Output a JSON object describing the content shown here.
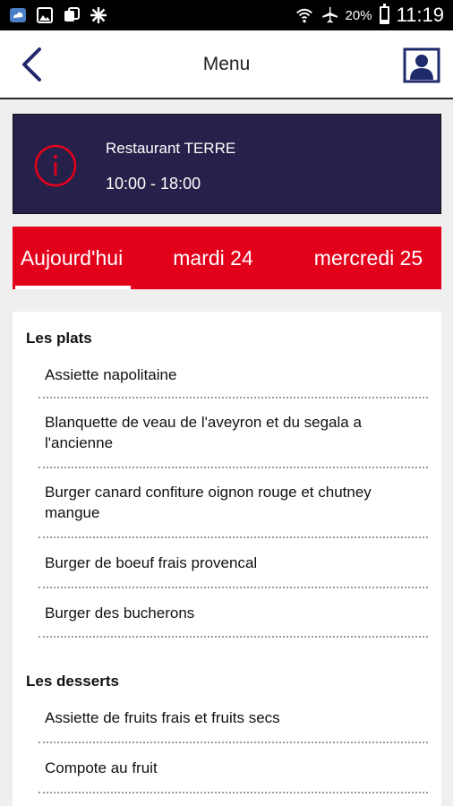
{
  "status_bar": {
    "battery_percent": "20%",
    "battery_level": 0.2,
    "time": "11:19",
    "icons": [
      "weather-icon",
      "image-icon",
      "app-icon",
      "sparkle-icon",
      "wifi-icon",
      "airplane-icon"
    ]
  },
  "app_bar": {
    "title": "Menu",
    "back_icon": "chevron-left-icon",
    "profile_icon": "person-icon"
  },
  "restaurant": {
    "name": "Restaurant TERRE",
    "hours": "10:00 - 18:00",
    "info_icon": "info-icon"
  },
  "tabs": [
    {
      "label": "Aujourd'hui",
      "active": true
    },
    {
      "label": "mardi 24",
      "active": false
    },
    {
      "label": "mercredi 25",
      "active": false
    }
  ],
  "menu": {
    "sections": [
      {
        "title": "Les plats",
        "items": [
          "Assiette napolitaine",
          "Blanquette de veau de l'aveyron et du segala a l'ancienne",
          "Burger canard confiture oignon rouge et chutney mangue",
          "Burger de boeuf frais provencal",
          "Burger des bucherons"
        ]
      },
      {
        "title": "Les desserts",
        "items": [
          "Assiette de fruits frais et fruits secs",
          "Compote au fruit"
        ]
      }
    ]
  },
  "colors": {
    "accent_red": "#e3001b",
    "banner_navy": "#26214a",
    "brand_blue": "#1f2a6b"
  }
}
